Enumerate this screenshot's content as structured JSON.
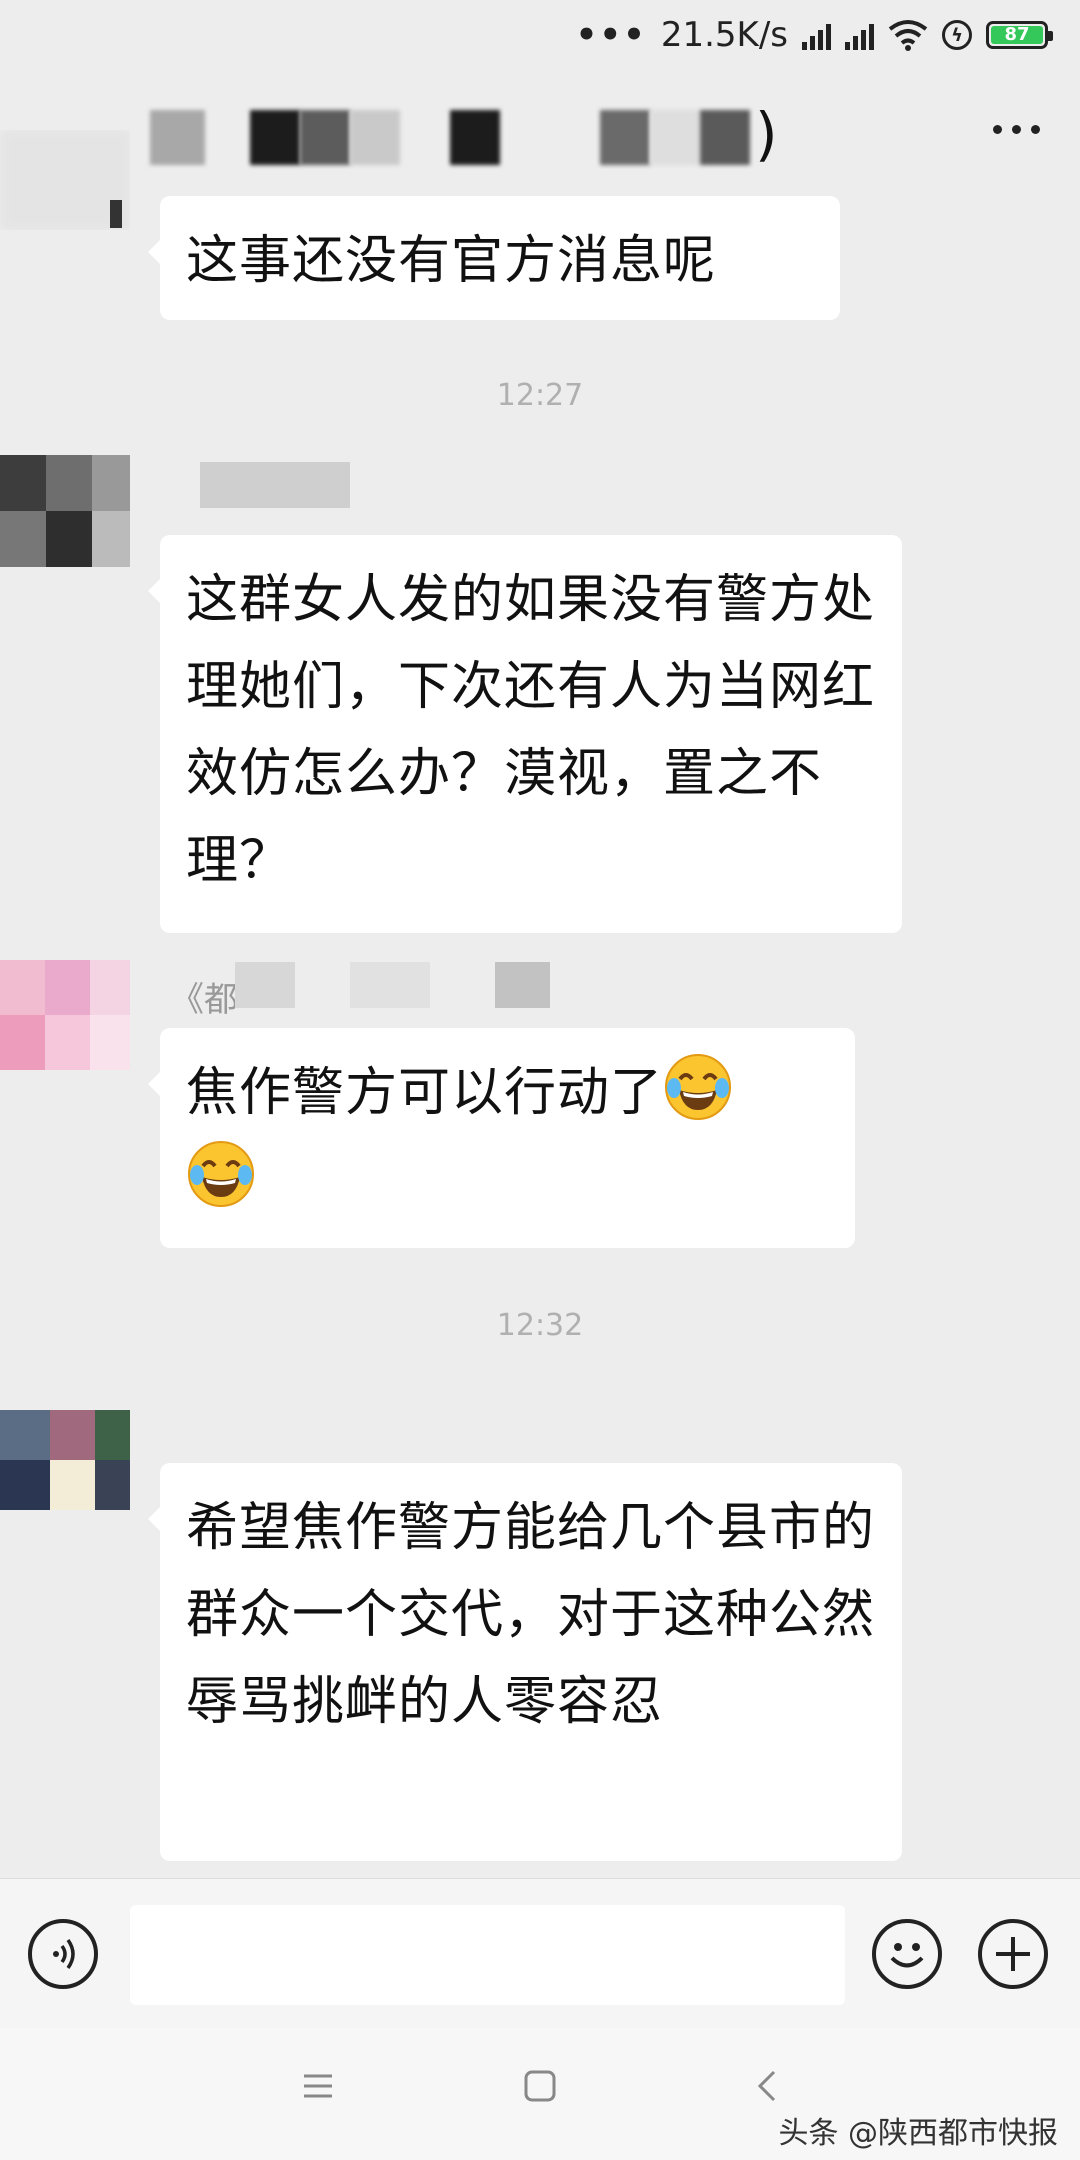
{
  "status_bar": {
    "network_speed": "21.5K/s",
    "battery_level": "87",
    "icons": [
      "more-dots-icon",
      "signal-icon",
      "signal-icon",
      "wifi-icon",
      "charging-icon",
      "battery-icon"
    ]
  },
  "header": {
    "icons": [
      "more-options-icon"
    ]
  },
  "messages": [
    {
      "text": "这事还没有官方消息呢"
    },
    {
      "time": "12:27"
    },
    {
      "text": "这群女人发的如果没有警方处理她们，下次还有人为当网红效仿怎么办？漠视，置之不理？"
    },
    {
      "name_fragment": "《都",
      "text": "焦作警方可以行动了",
      "emoji": [
        "tears-of-joy-emoji",
        "tears-of-joy-emoji"
      ]
    },
    {
      "time": "12:32"
    },
    {
      "text": "希望焦作警方能给几个县市的群众一个交代，对于这种公然辱骂挑衅的人零容忍"
    }
  ],
  "input_bar": {
    "icons": [
      "voice-icon",
      "emoji-icon",
      "plus-icon"
    ],
    "placeholder": ""
  },
  "nav_bar": {
    "icons": [
      "menu-icon",
      "home-icon",
      "back-icon"
    ]
  },
  "watermark": "头条 @陕西都市快报",
  "colors": {
    "background": "#ededed",
    "bubble": "#ffffff",
    "battery": "#34c759"
  }
}
